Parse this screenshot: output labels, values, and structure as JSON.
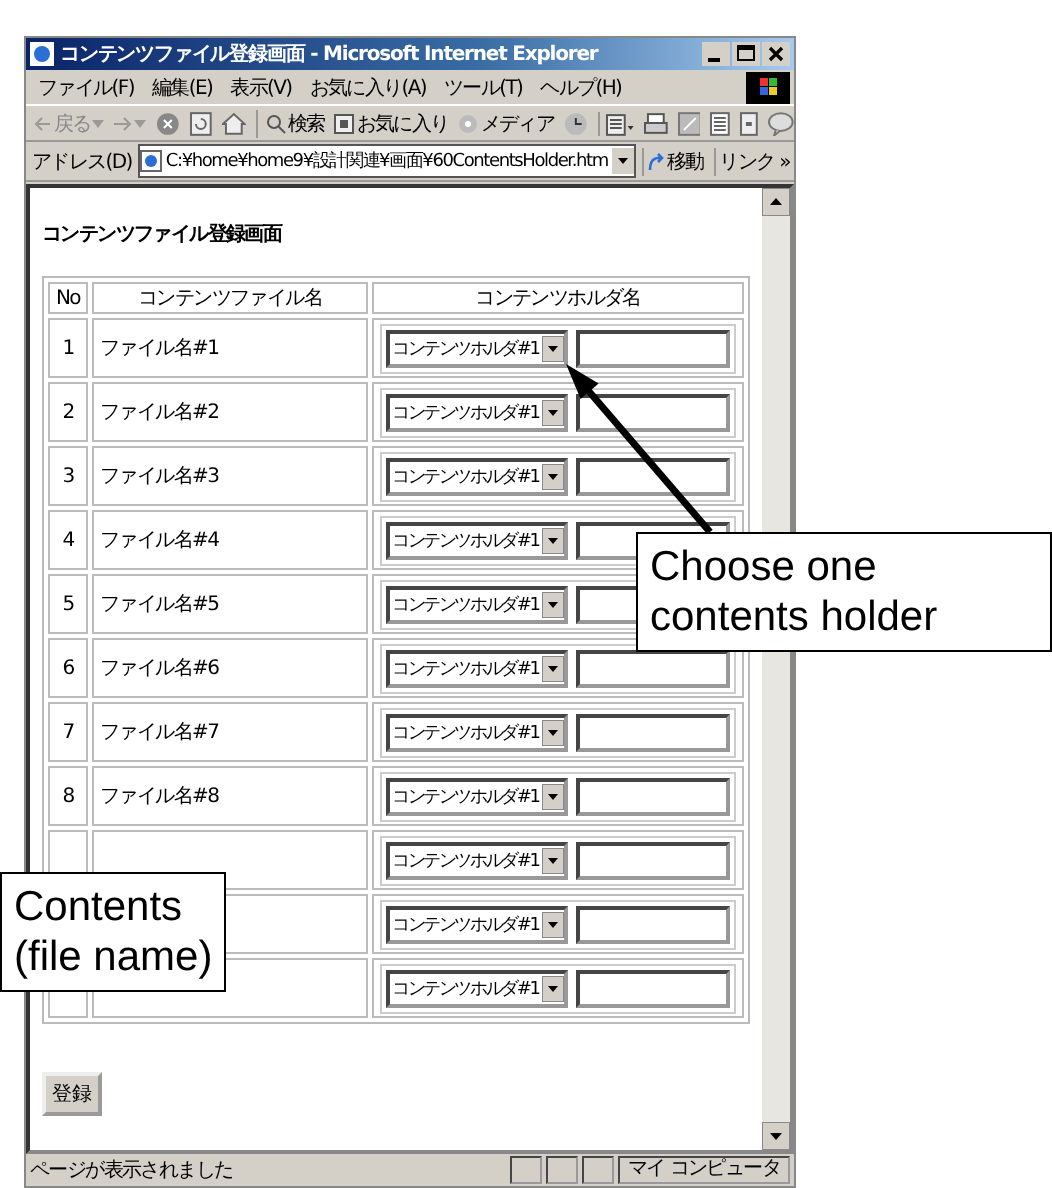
{
  "window": {
    "title": "コンテンツファイル登録画面 - Microsoft Internet Explorer"
  },
  "menu": [
    "ファイル(F)",
    "編集(E)",
    "表示(V)",
    "お気に入り(A)",
    "ツール(T)",
    "ヘルプ(H)"
  ],
  "toolbar": [
    {
      "kind": "back",
      "label": "戻る"
    },
    {
      "kind": "forward"
    },
    {
      "kind": "stop"
    },
    {
      "kind": "refresh"
    },
    {
      "kind": "home"
    },
    {
      "kind": "search",
      "label": "検索"
    },
    {
      "kind": "favorites",
      "label": "お気に入り"
    },
    {
      "kind": "media",
      "label": "メディア"
    },
    {
      "kind": "history"
    },
    {
      "kind": "mail"
    },
    {
      "kind": "print"
    },
    {
      "kind": "edit"
    },
    {
      "kind": "discuss"
    },
    {
      "kind": "research"
    },
    {
      "kind": "messenger"
    }
  ],
  "address": {
    "label": "アドレス(D)",
    "value": "C:¥home¥home9¥設計関連¥画面¥60ContentsHolder.htm",
    "go": "移動",
    "links": "リンク »"
  },
  "page": {
    "heading": "コンテンツファイル登録画面",
    "columns": [
      "No",
      "コンテンツファイル名",
      "コンテンツホルダ名"
    ],
    "rows": [
      {
        "no": "1",
        "file_name": "ファイル名#1",
        "holder": "コンテンツホルダ#1"
      },
      {
        "no": "2",
        "file_name": "ファイル名#2",
        "holder": "コンテンツホルダ#1"
      },
      {
        "no": "3",
        "file_name": "ファイル名#3",
        "holder": "コンテンツホルダ#1"
      },
      {
        "no": "4",
        "file_name": "ファイル名#4",
        "holder": "コンテンツホルダ#1"
      },
      {
        "no": "5",
        "file_name": "ファイル名#5",
        "holder": "コンテンツホルダ#1"
      },
      {
        "no": "6",
        "file_name": "ファイル名#6",
        "holder": "コンテンツホルダ#1"
      },
      {
        "no": "7",
        "file_name": "ファイル名#7",
        "holder": "コンテンツホルダ#1"
      },
      {
        "no": "8",
        "file_name": "ファイル名#8",
        "holder": "コンテンツホルダ#1"
      },
      {
        "holder": "コンテンツホルダ#1"
      },
      {
        "holder": "コンテンツホルダ#1"
      },
      {
        "holder": "コンテンツホルダ#1"
      }
    ],
    "submit": "登録"
  },
  "status_bar": {
    "text": "ページが表示されました",
    "zone": "マイ コンピュータ"
  },
  "callouts": [
    {
      "kind": "holder",
      "lines": [
        "Choose one",
        "contents holder"
      ]
    },
    {
      "kind": "file",
      "lines": [
        "Contents",
        "(file name)"
      ]
    }
  ]
}
